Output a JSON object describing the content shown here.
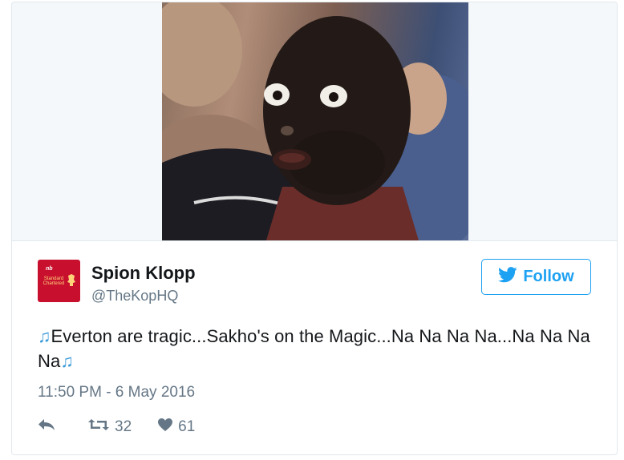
{
  "tweet": {
    "author_name": "Spion Klopp",
    "author_handle": "@TheKopHQ",
    "avatar_sponsor_text": "Standard Chartered",
    "follow_label": "Follow",
    "text": "Everton are tragic...Sakho's on the Magic...Na Na Na Na...Na Na Na Na",
    "note_emoji": "♫",
    "timestamp": "11:50 PM - 6 May 2016",
    "retweet_count": "32",
    "like_count": "61"
  },
  "colors": {
    "accent": "#1da1f2",
    "text": "#14171a",
    "muted": "#657786",
    "border": "#e1e8ed",
    "avatar_bg": "#c8102e"
  },
  "icons": [
    "twitter-bird-icon",
    "reply-icon",
    "retweet-icon",
    "heart-icon",
    "music-note-icon"
  ]
}
